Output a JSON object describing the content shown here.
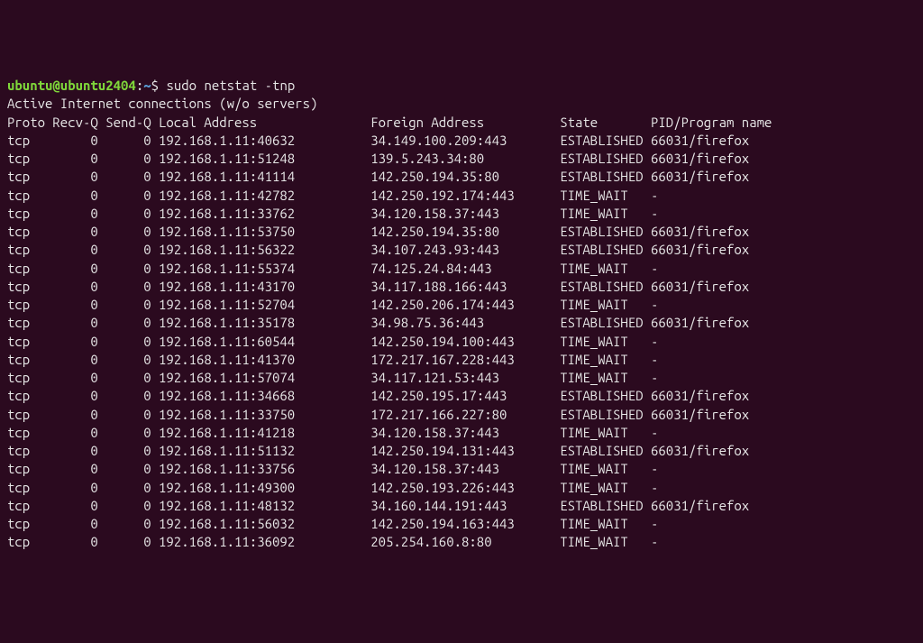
{
  "fragment_line": "----- ---- - ---- - ----- ----- -------         ------- -------           -----       ---/------- ----",
  "prompt": {
    "user_host": "ubuntu@ubuntu2404",
    "colon": ":",
    "path": "~",
    "dollar": "$",
    "command": "sudo netstat -tnp"
  },
  "header1": "Active Internet connections (w/o servers)",
  "headers": {
    "proto": "Proto",
    "recvq": "Recv-Q",
    "sendq": "Send-Q",
    "local": "Local Address",
    "foreign": "Foreign Address",
    "state": "State",
    "pid": "PID/Program name"
  },
  "rows": [
    {
      "proto": "tcp",
      "recvq": "0",
      "sendq": "0",
      "local": "192.168.1.11:40632",
      "foreign": "34.149.100.209:443",
      "state": "ESTABLISHED",
      "pid": "66031/firefox"
    },
    {
      "proto": "tcp",
      "recvq": "0",
      "sendq": "0",
      "local": "192.168.1.11:51248",
      "foreign": "139.5.243.34:80",
      "state": "ESTABLISHED",
      "pid": "66031/firefox"
    },
    {
      "proto": "tcp",
      "recvq": "0",
      "sendq": "0",
      "local": "192.168.1.11:41114",
      "foreign": "142.250.194.35:80",
      "state": "ESTABLISHED",
      "pid": "66031/firefox"
    },
    {
      "proto": "tcp",
      "recvq": "0",
      "sendq": "0",
      "local": "192.168.1.11:42782",
      "foreign": "142.250.192.174:443",
      "state": "TIME_WAIT",
      "pid": "-"
    },
    {
      "proto": "tcp",
      "recvq": "0",
      "sendq": "0",
      "local": "192.168.1.11:33762",
      "foreign": "34.120.158.37:443",
      "state": "TIME_WAIT",
      "pid": "-"
    },
    {
      "proto": "tcp",
      "recvq": "0",
      "sendq": "0",
      "local": "192.168.1.11:53750",
      "foreign": "142.250.194.35:80",
      "state": "ESTABLISHED",
      "pid": "66031/firefox"
    },
    {
      "proto": "tcp",
      "recvq": "0",
      "sendq": "0",
      "local": "192.168.1.11:56322",
      "foreign": "34.107.243.93:443",
      "state": "ESTABLISHED",
      "pid": "66031/firefox"
    },
    {
      "proto": "tcp",
      "recvq": "0",
      "sendq": "0",
      "local": "192.168.1.11:55374",
      "foreign": "74.125.24.84:443",
      "state": "TIME_WAIT",
      "pid": "-"
    },
    {
      "proto": "tcp",
      "recvq": "0",
      "sendq": "0",
      "local": "192.168.1.11:43170",
      "foreign": "34.117.188.166:443",
      "state": "ESTABLISHED",
      "pid": "66031/firefox"
    },
    {
      "proto": "tcp",
      "recvq": "0",
      "sendq": "0",
      "local": "192.168.1.11:52704",
      "foreign": "142.250.206.174:443",
      "state": "TIME_WAIT",
      "pid": "-"
    },
    {
      "proto": "tcp",
      "recvq": "0",
      "sendq": "0",
      "local": "192.168.1.11:35178",
      "foreign": "34.98.75.36:443",
      "state": "ESTABLISHED",
      "pid": "66031/firefox"
    },
    {
      "proto": "tcp",
      "recvq": "0",
      "sendq": "0",
      "local": "192.168.1.11:60544",
      "foreign": "142.250.194.100:443",
      "state": "TIME_WAIT",
      "pid": "-"
    },
    {
      "proto": "tcp",
      "recvq": "0",
      "sendq": "0",
      "local": "192.168.1.11:41370",
      "foreign": "172.217.167.228:443",
      "state": "TIME_WAIT",
      "pid": "-"
    },
    {
      "proto": "tcp",
      "recvq": "0",
      "sendq": "0",
      "local": "192.168.1.11:57074",
      "foreign": "34.117.121.53:443",
      "state": "TIME_WAIT",
      "pid": "-"
    },
    {
      "proto": "tcp",
      "recvq": "0",
      "sendq": "0",
      "local": "192.168.1.11:34668",
      "foreign": "142.250.195.17:443",
      "state": "ESTABLISHED",
      "pid": "66031/firefox"
    },
    {
      "proto": "tcp",
      "recvq": "0",
      "sendq": "0",
      "local": "192.168.1.11:33750",
      "foreign": "172.217.166.227:80",
      "state": "ESTABLISHED",
      "pid": "66031/firefox"
    },
    {
      "proto": "tcp",
      "recvq": "0",
      "sendq": "0",
      "local": "192.168.1.11:41218",
      "foreign": "34.120.158.37:443",
      "state": "TIME_WAIT",
      "pid": "-"
    },
    {
      "proto": "tcp",
      "recvq": "0",
      "sendq": "0",
      "local": "192.168.1.11:51132",
      "foreign": "142.250.194.131:443",
      "state": "ESTABLISHED",
      "pid": "66031/firefox"
    },
    {
      "proto": "tcp",
      "recvq": "0",
      "sendq": "0",
      "local": "192.168.1.11:33756",
      "foreign": "34.120.158.37:443",
      "state": "TIME_WAIT",
      "pid": "-"
    },
    {
      "proto": "tcp",
      "recvq": "0",
      "sendq": "0",
      "local": "192.168.1.11:49300",
      "foreign": "142.250.193.226:443",
      "state": "TIME_WAIT",
      "pid": "-"
    },
    {
      "proto": "tcp",
      "recvq": "0",
      "sendq": "0",
      "local": "192.168.1.11:48132",
      "foreign": "34.160.144.191:443",
      "state": "ESTABLISHED",
      "pid": "66031/firefox"
    },
    {
      "proto": "tcp",
      "recvq": "0",
      "sendq": "0",
      "local": "192.168.1.11:56032",
      "foreign": "142.250.194.163:443",
      "state": "TIME_WAIT",
      "pid": "-"
    },
    {
      "proto": "tcp",
      "recvq": "0",
      "sendq": "0",
      "local": "192.168.1.11:36092",
      "foreign": "205.254.160.8:80",
      "state": "TIME_WAIT",
      "pid": "-"
    }
  ]
}
